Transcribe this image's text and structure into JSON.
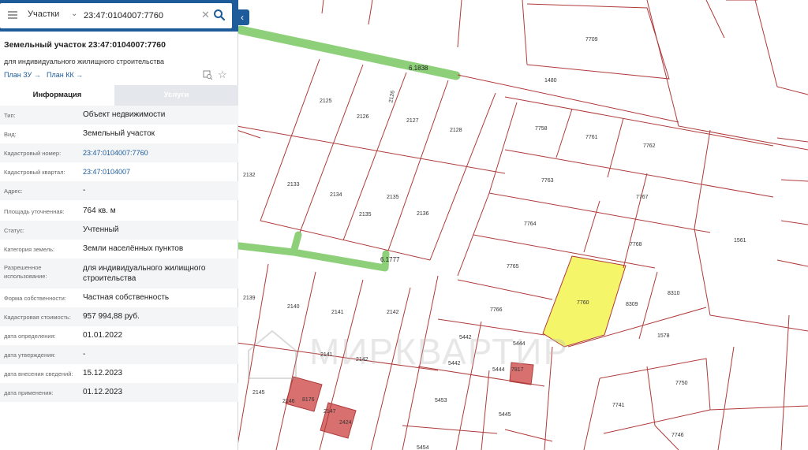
{
  "search": {
    "layer": "Участки",
    "query": "23:47:0104007:7760"
  },
  "parcel": {
    "title": "Земельный участок 23:47:0104007:7760",
    "subtitle": "для индивидуального жилищного строительства",
    "plan_zu": "План ЗУ →",
    "plan_kk": "План КК →"
  },
  "tabs": {
    "info": "Информация",
    "services": "Услуги"
  },
  "fields": [
    {
      "label": "Тип:",
      "value": "Объект недвижимости"
    },
    {
      "label": "Вид:",
      "value": "Земельный участок"
    },
    {
      "label": "Кадастровый номер:",
      "value": "23:47:0104007:7760"
    },
    {
      "label": "Кадастровый квартал:",
      "value": "23:47:0104007"
    },
    {
      "label": "Адрес:",
      "value": "-"
    },
    {
      "label": "Площадь уточненная:",
      "value": "764 кв. м"
    },
    {
      "label": "Статус:",
      "value": "Учтенный"
    },
    {
      "label": "Категория земель:",
      "value": "Земли населённых пунктов"
    },
    {
      "label": "Разрешенное использование:",
      "value": "для индивидуального жилищного строительства"
    },
    {
      "label": "Форма собственности:",
      "value": "Частная собственность"
    },
    {
      "label": "Кадастровая стоимость:",
      "value": "957 994,88 руб."
    },
    {
      "label": "дата определения:",
      "value": "01.01.2022"
    },
    {
      "label": "дата утверждения:",
      "value": "-"
    },
    {
      "label": "дата внесения сведений:",
      "value": "15.12.2023"
    },
    {
      "label": "дата применения:",
      "value": "01.12.2023"
    }
  ],
  "map": {
    "roads": [
      "6.1838",
      "6.1777"
    ],
    "watermark": "МИРКВАРТИР",
    "plots": [
      "7709",
      "1480",
      "2125",
      "2126",
      "2126",
      "2127",
      "2128",
      "7758",
      "7761",
      "7762",
      "2132",
      "2133",
      "2134",
      "2135",
      "2136",
      "7763",
      "7767",
      "7764",
      "7768",
      "1561",
      "7765",
      "7760",
      "8309",
      "8310",
      "2139",
      "2140",
      "2141",
      "2142",
      "7766",
      "5442",
      "5444",
      "1578",
      "2141",
      "2142",
      "2142",
      "5442",
      "5444",
      "7817",
      "2145",
      "2146",
      "8176",
      "2147",
      "2424",
      "5453",
      "5445",
      "7750",
      "7741",
      "5454",
      "7746"
    ],
    "colors": {
      "selected": "#f5f56a",
      "building": "#d97070",
      "road": "#8ed07a",
      "boundary": "#b03a3a"
    }
  }
}
